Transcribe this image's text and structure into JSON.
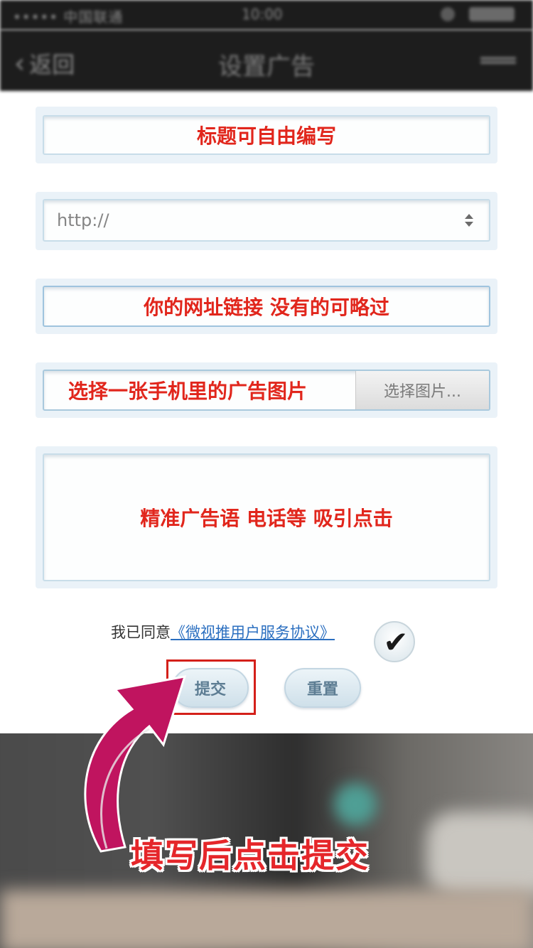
{
  "status_bar": {
    "carrier": "••••• 中国联通",
    "time": "10:00"
  },
  "nav": {
    "back_label": "返回",
    "title": "设置广告"
  },
  "form": {
    "title_note": "标题可自由编写",
    "url_select_value": "http://",
    "link_note": "你的网址链接  没有的可略过",
    "image_note": "选择一张手机里的广告图片",
    "choose_image_button": "选择图片...",
    "ad_text_note": "精准广告语  电话等  吸引点击"
  },
  "agreement": {
    "prefix": "我已同意",
    "link": "《微视推用户服务协议》",
    "checked": true
  },
  "buttons": {
    "submit": "提交",
    "reset": "重置"
  },
  "banner": {
    "caption": "填写后点击提交"
  },
  "colors": {
    "annotation_red": "#e1261c",
    "link_blue": "#2b6fc0",
    "arrow_magenta": "#c0145f"
  }
}
